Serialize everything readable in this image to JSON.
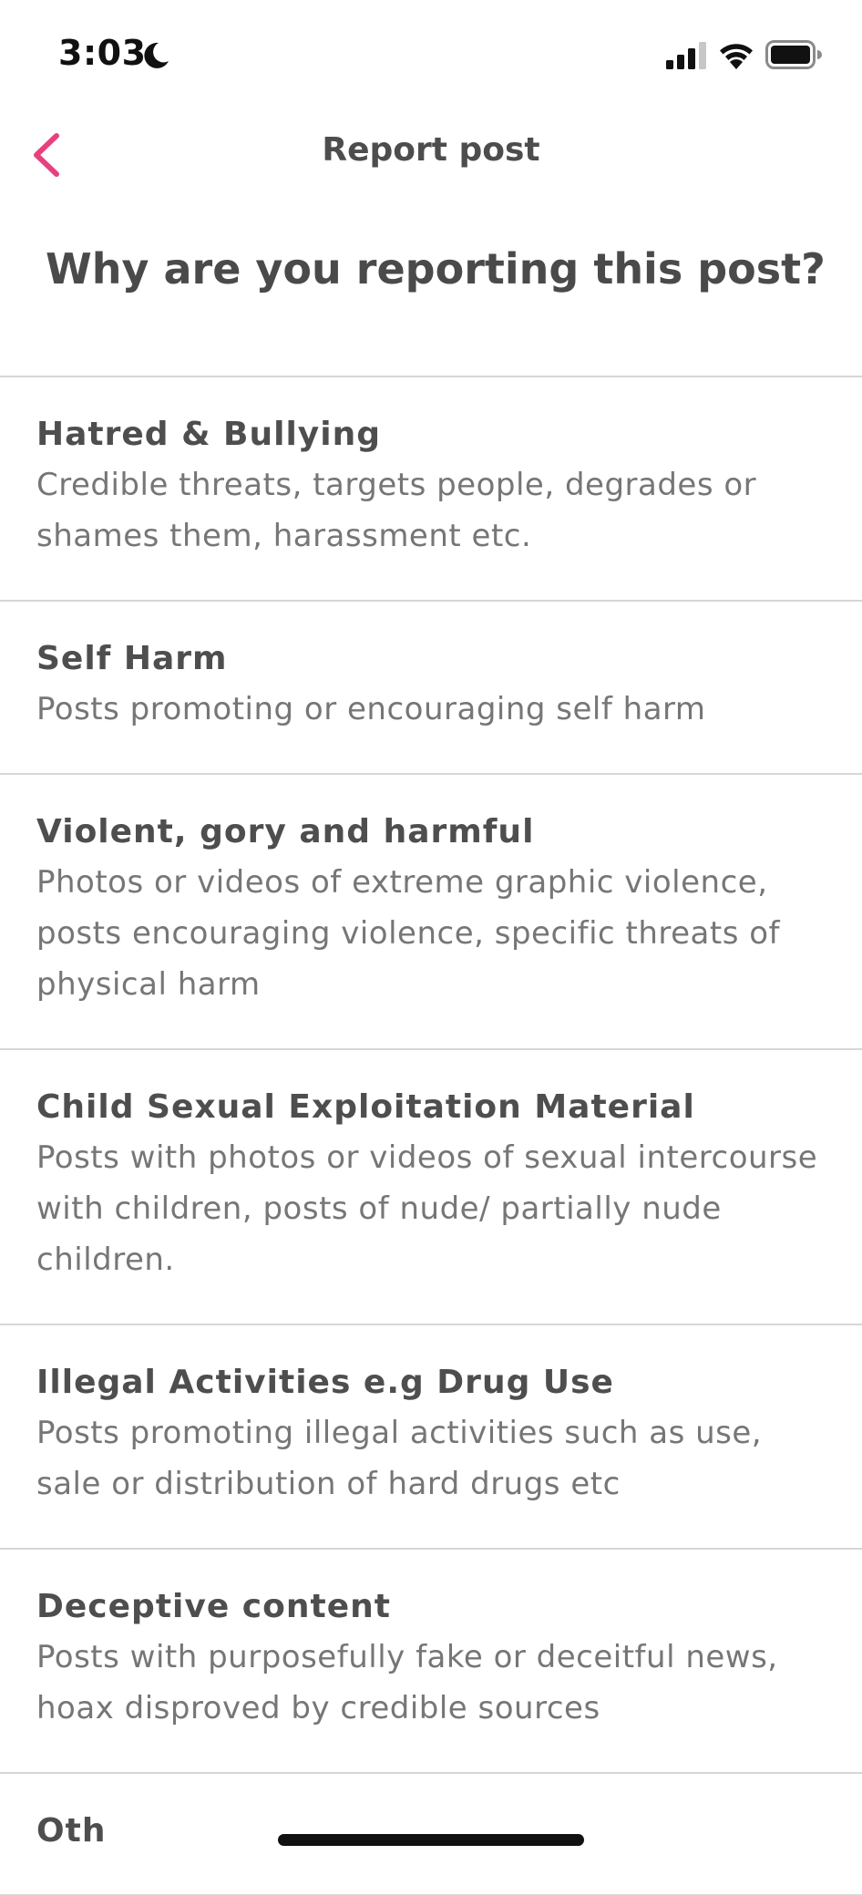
{
  "status_bar": {
    "time": "3:03",
    "moon_icon": "moon-icon",
    "signal_icon": "cellular-signal-icon",
    "wifi_icon": "wifi-icon",
    "battery_icon": "battery-icon"
  },
  "nav": {
    "back_icon": "chevron-left-icon",
    "title": "Report post"
  },
  "heading": "Why are you reporting this post?",
  "accent_color": "#e8407e",
  "reasons": [
    {
      "title": "Hatred & Bullying",
      "description": "Credible threats, targets people, degrades or shames them, harassment etc."
    },
    {
      "title": "Self Harm",
      "description": "Posts promoting or encouraging self harm"
    },
    {
      "title": "Violent, gory and harmful",
      "description": "Photos or videos of extreme graphic violence, posts encouraging violence, specific threats of physical harm"
    },
    {
      "title": "Child Sexual Exploitation Material",
      "description": "Posts with photos or videos of sexual intercourse with children, posts of nude/ partially nude children."
    },
    {
      "title": "Illegal Activities e.g Drug Use",
      "description": "Posts promoting illegal activities such as use, sale or distribution of hard drugs etc"
    },
    {
      "title": "Deceptive content",
      "description": "Posts with purposefully fake or deceitful news, hoax disproved by credible sources"
    },
    {
      "title": "Oth",
      "description": ""
    }
  ]
}
